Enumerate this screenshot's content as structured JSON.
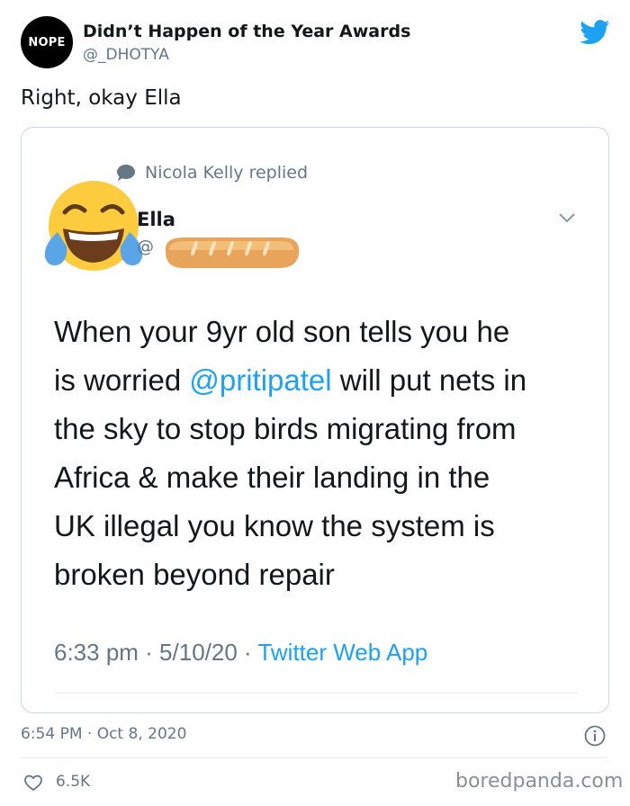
{
  "account": {
    "avatar_text": "NOPE",
    "name": "Didn’t Happen of the Year Awards",
    "handle": "@_DHOTYA"
  },
  "tweet": {
    "text": "Right, okay Ella",
    "timestamp": "6:54 PM · Oct 8, 2020",
    "like_count": "6.5K"
  },
  "embedded": {
    "reply_context": "Nicola Kelly replied",
    "name": "Ella",
    "handle_visible": "@",
    "body_lines": [
      {
        "before": "When your 9yr old son tells you he",
        "mention": "",
        "after": ""
      },
      {
        "before": "is worried ",
        "mention": "@pritipatel",
        "after": " will put nets in"
      },
      {
        "before": "the sky to stop birds migrating from",
        "mention": "",
        "after": ""
      },
      {
        "before": "Africa & make their landing in the",
        "mention": "",
        "after": ""
      },
      {
        "before": "UK illegal you know the system is",
        "mention": "",
        "after": ""
      },
      {
        "before": "broken beyond repair",
        "mention": "",
        "after": ""
      }
    ],
    "meta_time": "6:33 pm · 5/10/20 · ",
    "meta_source": "Twitter Web App"
  },
  "icons": {
    "brand": "twitter-bird-icon",
    "reply": "speech-bubble-icon",
    "avatar": "tears-of-joy-emoji",
    "redaction": "baguette-sticker",
    "menu": "chevron-down-icon",
    "info": "info-icon",
    "like": "heart-outline-icon"
  },
  "colors": {
    "link": "#1da1f2",
    "secondary_text": "#657786",
    "border": "#ccd6dd"
  },
  "watermark": "boredpanda.com"
}
